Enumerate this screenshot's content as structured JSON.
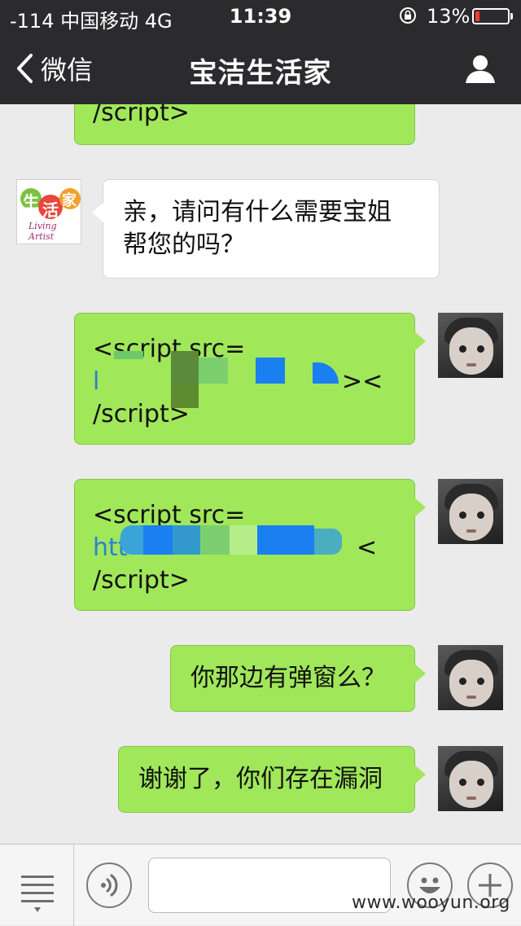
{
  "status_bar": {
    "carrier": "-114 中国移动  4G",
    "time": "11:39",
    "battery_percent": "13%",
    "battery_level": 0.13
  },
  "nav": {
    "back_label": "微信",
    "title": "宝洁生活家",
    "back_icon": "chevron-left-icon",
    "user_icon": "person-icon"
  },
  "messages": {
    "m1": {
      "lines": [
        "/script>"
      ]
    },
    "m2": {
      "lines": [
        "亲，请问有什么需要宝姐",
        "帮您的吗？"
      ]
    },
    "m3": {
      "lines": [
        " <script src=",
        "l",
        "><",
        "/script>"
      ]
    },
    "m4": {
      "lines": [
        " <script src=",
        "htt",
        "<",
        "/script>"
      ]
    },
    "m5": {
      "lines": [
        "你那边有弹窗么？"
      ]
    },
    "m6": {
      "lines": [
        "谢谢了，你们存在漏洞"
      ]
    }
  },
  "brand_avatar": {
    "chars": [
      "生",
      "活",
      "家"
    ],
    "subtitle": "Living Artist"
  },
  "toolbar": {
    "menu_icon": "menu-icon",
    "voice_icon": "voice-icon",
    "emoji_icon": "emoji-icon",
    "plus_icon": "plus-icon",
    "input_value": ""
  },
  "watermark": "www.wooyun.org",
  "colors": {
    "nav_bg": "#2b2b2d",
    "chat_bg": "#ebebeb",
    "bubble_green": "#a0e75a",
    "link": "#2a7fd6",
    "battery_low": "#ff3b30"
  }
}
